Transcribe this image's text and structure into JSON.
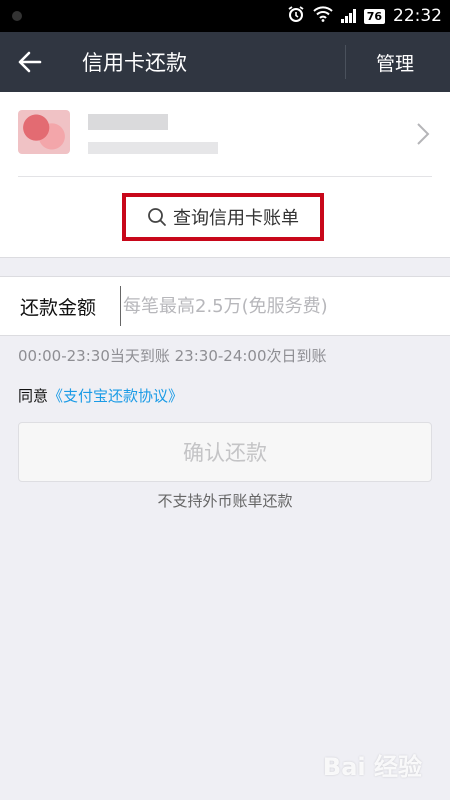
{
  "status_bar": {
    "time": "22:32",
    "battery": "76",
    "icons": [
      "alarm-icon",
      "wifi-icon",
      "signal-icon",
      "battery-icon"
    ]
  },
  "title_bar": {
    "title": "信用卡还款",
    "manage_label": "管理"
  },
  "card": {
    "query_label": "查询信用卡账单"
  },
  "amount": {
    "label": "还款金额",
    "placeholder": "每笔最高2.5万(免服务费)"
  },
  "arrival_note": "00:00-23:30当天到账 23:30-24:00次日到账",
  "agreement": {
    "prefix": "同意",
    "link": "《支付宝还款协议》"
  },
  "confirm_label": "确认还款",
  "foreign_note": "不支持外币账单还款",
  "watermark": "Bai 经验",
  "colors": {
    "title_bar_bg": "#303641",
    "highlight_border": "#c8071a",
    "link": "#1a9be6",
    "page_bg": "#efeff4"
  }
}
